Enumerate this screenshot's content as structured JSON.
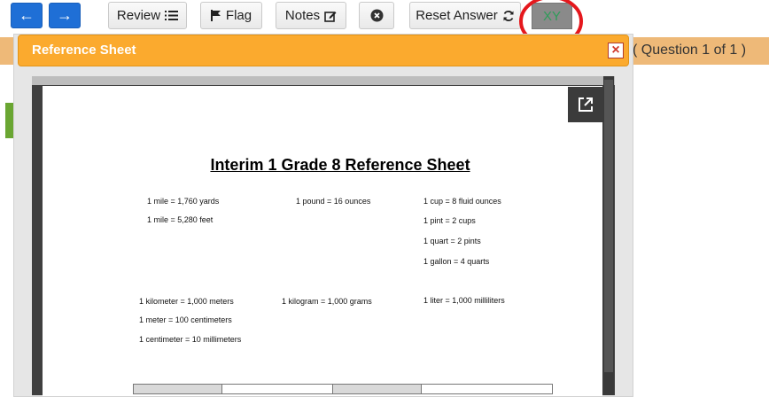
{
  "toolbar": {
    "back_icon": "arrow-left-icon",
    "forward_icon": "arrow-right-icon",
    "review_label": "Review",
    "flag_label": "Flag",
    "notes_label": "Notes",
    "reset_label": "Reset Answer",
    "xy_label": "XY"
  },
  "question": {
    "counter": "( Question 1 of 1 )"
  },
  "modal": {
    "title": "Reference Sheet"
  },
  "sheet": {
    "title": "Interim 1 Grade 8 Reference Sheet",
    "col1_top": [
      "1 mile = 1,760 yards",
      "1 mile = 5,280 feet"
    ],
    "col2_top": [
      "1 pound = 16 ounces"
    ],
    "col3_top": [
      "1 cup = 8 fluid ounces",
      "1 pint = 2 cups",
      "1 quart = 2 pints",
      "1 gallon = 4 quarts"
    ],
    "col1_bottom": [
      "1 kilometer = 1,000 meters",
      "1 meter = 100 centimeters",
      "1 centimeter = 10 millimeters"
    ],
    "col2_bottom": [
      "1 kilogram = 1,000 grams"
    ],
    "col3_bottom": [
      "1 liter = 1,000 milliliters"
    ]
  },
  "colors": {
    "nav_blue": "#1f6fd6",
    "modal_orange": "#fbaa2e",
    "question_bar": "#eeb978",
    "highlight_red": "#e5181d",
    "xy_green": "#2f9c5a"
  }
}
